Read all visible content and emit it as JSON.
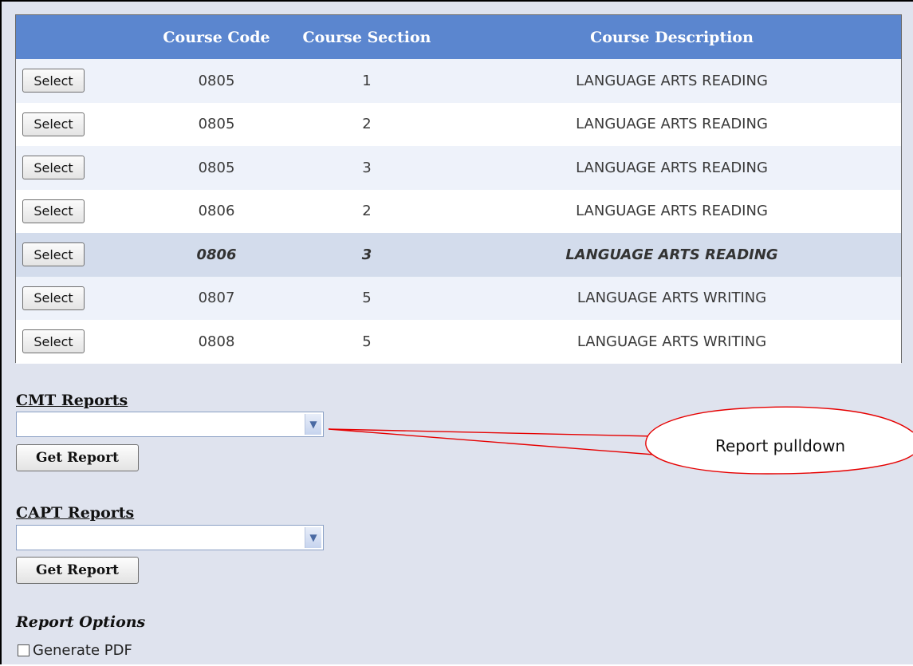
{
  "grid": {
    "headers": {
      "code": "Course Code",
      "section": "Course Section",
      "description": "Course Description"
    },
    "select_label": "Select",
    "rows": [
      {
        "code": "0805",
        "section": "1",
        "description": "LANGUAGE ARTS READING"
      },
      {
        "code": "0805",
        "section": "2",
        "description": "LANGUAGE ARTS READING"
      },
      {
        "code": "0805",
        "section": "3",
        "description": "LANGUAGE ARTS READING"
      },
      {
        "code": "0806",
        "section": "2",
        "description": "LANGUAGE ARTS READING"
      },
      {
        "code": "0806",
        "section": "3",
        "description": "LANGUAGE ARTS READING"
      },
      {
        "code": "0807",
        "section": "5",
        "description": "LANGUAGE ARTS WRITING"
      },
      {
        "code": "0808",
        "section": "5",
        "description": "LANGUAGE ARTS WRITING"
      }
    ]
  },
  "cmt": {
    "title": "CMT Reports",
    "selected_value": "",
    "button_label": "Get Report"
  },
  "capt": {
    "title": "CAPT Reports",
    "selected_value": "",
    "button_label": "Get Report"
  },
  "options": {
    "title": "Report Options",
    "pdf_label": "Generate PDF",
    "pdf_checked": false
  },
  "callout": {
    "text": "Report pulldown"
  },
  "colors": {
    "header_bg": "#5b86cf",
    "page_bg": "#dfe3ee",
    "callout": "#e60000"
  }
}
